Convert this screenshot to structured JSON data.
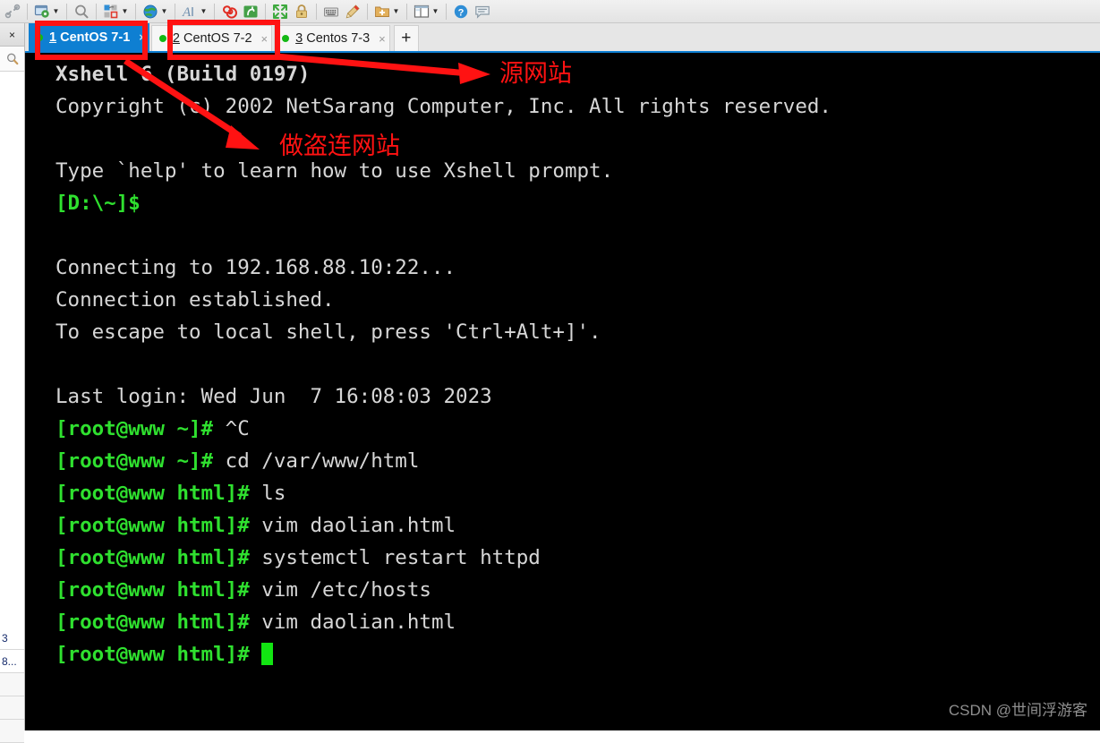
{
  "app": {
    "name": "Xshell 6"
  },
  "toolbar": {
    "items": [
      {
        "name": "link-chain-icon",
        "caret": false
      },
      {
        "sep": true
      },
      {
        "name": "session-properties-icon",
        "caret": true
      },
      {
        "sep": true
      },
      {
        "name": "search-icon",
        "caret": false
      },
      {
        "sep": true
      },
      {
        "name": "transfer-file-icon",
        "caret": true
      },
      {
        "sep": true
      },
      {
        "name": "globe-icon",
        "caret": true
      },
      {
        "sep": true
      },
      {
        "name": "font-icon",
        "caret": true
      },
      {
        "sep": true
      },
      {
        "name": "spiral-icon",
        "caret": false
      },
      {
        "name": "xftp-icon",
        "caret": false
      },
      {
        "sep": true
      },
      {
        "name": "fullscreen-icon",
        "caret": false
      },
      {
        "name": "lock-icon",
        "caret": false
      },
      {
        "sep": true
      },
      {
        "name": "keyboard-icon",
        "caret": false
      },
      {
        "name": "highlight-pen-icon",
        "caret": false
      },
      {
        "sep": true
      },
      {
        "name": "new-folder-icon",
        "caret": true
      },
      {
        "sep": true
      },
      {
        "name": "layout-icon",
        "caret": true
      },
      {
        "sep": true
      },
      {
        "name": "help-icon",
        "caret": false
      },
      {
        "name": "feedback-icon",
        "caret": false
      }
    ]
  },
  "left_dock": {
    "close_label": "×",
    "search_icon": "magnifier-icon",
    "rows": [
      {
        "text": "3"
      },
      {
        "text": "8..."
      },
      {
        "text": ""
      },
      {
        "text": ""
      },
      {
        "text": ""
      }
    ]
  },
  "tabs": {
    "items": [
      {
        "index": "1",
        "label": " CentOS 7-1",
        "active": true,
        "close": "×",
        "dot": "#14b814"
      },
      {
        "index": "2",
        "label": " CentOS 7-2",
        "active": false,
        "close": "×",
        "dot": "#14b814"
      },
      {
        "index": "3",
        "label": " Centos 7-3",
        "active": false,
        "close": "×",
        "dot": "#14b814"
      }
    ],
    "add_label": "+",
    "accent": "#0e7fd2"
  },
  "terminal": {
    "colors": {
      "background": "#000000",
      "foreground": "#d6d6d6",
      "prompt": "#2fe02f"
    },
    "lines": [
      {
        "segments": [
          {
            "text": "Xshell 6 (Build 0197)",
            "color": "white",
            "bold": true
          }
        ]
      },
      {
        "segments": [
          {
            "text": "Copyright (c) 2002 NetSarang Computer, Inc. All rights reserved.",
            "color": "white"
          }
        ]
      },
      {
        "segments": [
          {
            "text": "",
            "color": "white"
          }
        ]
      },
      {
        "segments": [
          {
            "text": "Type `help' to learn how to use Xshell prompt.",
            "color": "white"
          }
        ]
      },
      {
        "segments": [
          {
            "text": "[D:\\~]$",
            "color": "green"
          }
        ]
      },
      {
        "segments": [
          {
            "text": "",
            "color": "white"
          }
        ]
      },
      {
        "segments": [
          {
            "text": "Connecting to 192.168.88.10:22...",
            "color": "white"
          }
        ]
      },
      {
        "segments": [
          {
            "text": "Connection established.",
            "color": "white"
          }
        ]
      },
      {
        "segments": [
          {
            "text": "To escape to local shell, press 'Ctrl+Alt+]'.",
            "color": "white"
          }
        ]
      },
      {
        "segments": [
          {
            "text": "",
            "color": "white"
          }
        ]
      },
      {
        "segments": [
          {
            "text": "Last login: Wed Jun  7 16:08:03 2023",
            "color": "white"
          }
        ]
      },
      {
        "segments": [
          {
            "text": "[root@www ~]# ",
            "color": "green"
          },
          {
            "text": "^C",
            "color": "white"
          }
        ]
      },
      {
        "segments": [
          {
            "text": "[root@www ~]# ",
            "color": "green"
          },
          {
            "text": "cd /var/www/html",
            "color": "white"
          }
        ]
      },
      {
        "segments": [
          {
            "text": "[root@www html]# ",
            "color": "green"
          },
          {
            "text": "ls",
            "color": "white"
          }
        ]
      },
      {
        "segments": [
          {
            "text": "[root@www html]# ",
            "color": "green"
          },
          {
            "text": "vim daolian.html",
            "color": "white"
          }
        ]
      },
      {
        "segments": [
          {
            "text": "[root@www html]# ",
            "color": "green"
          },
          {
            "text": "systemctl restart httpd",
            "color": "white"
          }
        ]
      },
      {
        "segments": [
          {
            "text": "[root@www html]# ",
            "color": "green"
          },
          {
            "text": "vim /etc/hosts",
            "color": "white"
          }
        ]
      },
      {
        "segments": [
          {
            "text": "[root@www html]# ",
            "color": "green"
          },
          {
            "text": "vim daolian.html",
            "color": "white"
          }
        ]
      },
      {
        "segments": [
          {
            "text": "[root@www html]# ",
            "color": "green"
          },
          {
            "cursor": true
          }
        ]
      }
    ]
  },
  "annotations": {
    "color": "#ff1212",
    "source_site_label": "源网站",
    "hotlink_site_label": "做盗连网站"
  },
  "watermark": {
    "text": "CSDN @世间浮游客"
  }
}
